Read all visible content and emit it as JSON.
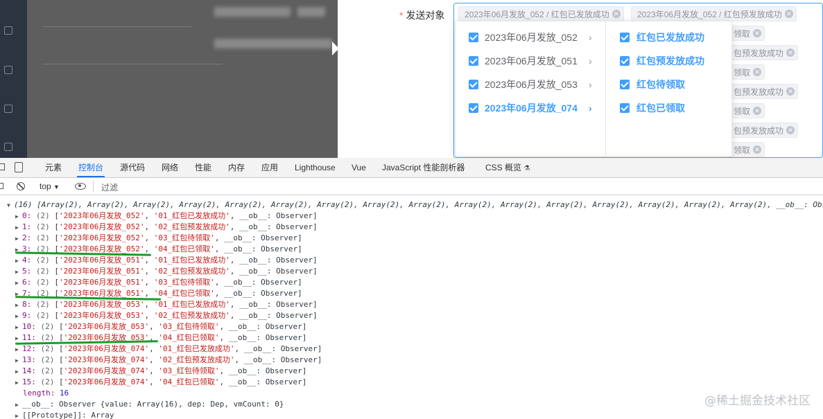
{
  "form": {
    "required_mark": "*",
    "label": "发送对象"
  },
  "selected_tags": [
    {
      "text": "2023年06月发放_052 / 红包已发放成功"
    },
    {
      "text": "2023年06月发放_052 / 红包预发放成功"
    },
    {
      "text": "领取"
    },
    {
      "text": "包预发放成功"
    },
    {
      "text": "领取"
    },
    {
      "text": "包预发放成功"
    },
    {
      "text": "领取"
    },
    {
      "text": "包预发放成功"
    },
    {
      "text": "领取"
    }
  ],
  "cascader": {
    "col1": [
      {
        "label": "2023年06月发放_052",
        "checked": true,
        "active": false
      },
      {
        "label": "2023年06月发放_051",
        "checked": true,
        "active": false
      },
      {
        "label": "2023年06月发放_053",
        "checked": true,
        "active": false
      },
      {
        "label": "2023年06月发放_074",
        "checked": true,
        "active": true
      }
    ],
    "col2": [
      {
        "label": "红包已发放成功",
        "checked": true
      },
      {
        "label": "红包预发放成功",
        "checked": true
      },
      {
        "label": "红包待领取",
        "checked": true
      },
      {
        "label": "红包已领取",
        "checked": true
      }
    ]
  },
  "devtools": {
    "tabs": [
      "元素",
      "控制台",
      "源代码",
      "网络",
      "性能",
      "内存",
      "应用",
      "Lighthouse",
      "Vue",
      "JavaScript 性能剖析器",
      "CSS 概览"
    ],
    "active_tab": "控制台",
    "context": "top",
    "filter_placeholder": "过滤"
  },
  "console": {
    "header": "(16) [Array(2), Array(2), Array(2), Array(2), Array(2), Array(2), Array(2), Array(2), Array(2), Array(2), Array(2), Array(2), Array(2), Array(2), Array(2), Array(2), __ob__: Obs",
    "rows": [
      {
        "idx": "0:",
        "cnt": "(2)",
        "a": "'2023年06月发放_052'",
        "b": "'01_红包已发放成功'",
        "tail": "__ob__: Observer]"
      },
      {
        "idx": "1:",
        "cnt": "(2)",
        "a": "'2023年06月发放_052'",
        "b": "'02_红包预发放成功'",
        "tail": "__ob__: Observer]"
      },
      {
        "idx": "2:",
        "cnt": "(2)",
        "a": "'2023年06月发放_052'",
        "b": "'03_红包待领取'",
        "tail": "__ob__: Observer]"
      },
      {
        "idx": "3:",
        "cnt": "(2)",
        "a": "'2023年06月发放_052'",
        "b": "'04_红包已领取'",
        "tail": "__ob__: Observer]"
      },
      {
        "idx": "4:",
        "cnt": "(2)",
        "a": "'2023年06月发放_051'",
        "b": "'01_红包已发放成功'",
        "tail": "__ob__: Observer]"
      },
      {
        "idx": "5:",
        "cnt": "(2)",
        "a": "'2023年06月发放_051'",
        "b": "'02_红包预发放成功'",
        "tail": "__ob__: Observer]"
      },
      {
        "idx": "6:",
        "cnt": "(2)",
        "a": "'2023年06月发放_051'",
        "b": "'03_红包待领取'",
        "tail": "__ob__: Observer]"
      },
      {
        "idx": "7:",
        "cnt": "(2)",
        "a": "'2023年06月发放_051'",
        "b": "'04_红包已领取'",
        "tail": "__ob__: Observer]"
      },
      {
        "idx": "8:",
        "cnt": "(2)",
        "a": "'2023年06月发放_053'",
        "b": "'01_红包已发放成功'",
        "tail": "__ob__: Observer]"
      },
      {
        "idx": "9:",
        "cnt": "(2)",
        "a": "'2023年06月发放_053'",
        "b": "'02_红包预发放成功'",
        "tail": "__ob__: Observer]"
      },
      {
        "idx": "10:",
        "cnt": "(2)",
        "a": "'2023年06月发放_053'",
        "b": "'03_红包待领取'",
        "tail": "__ob__: Observer]"
      },
      {
        "idx": "11:",
        "cnt": "(2)",
        "a": "'2023年06月发放_053'",
        "b": "'04_红包已领取'",
        "tail": "__ob__: Observer]"
      },
      {
        "idx": "12:",
        "cnt": "(2)",
        "a": "'2023年06月发放_074'",
        "b": "'01_红包已发放成功'",
        "tail": "__ob__: Observer]"
      },
      {
        "idx": "13:",
        "cnt": "(2)",
        "a": "'2023年06月发放_074'",
        "b": "'02_红包预发放成功'",
        "tail": "__ob__: Observer]"
      },
      {
        "idx": "14:",
        "cnt": "(2)",
        "a": "'2023年06月发放_074'",
        "b": "'03_红包待领取'",
        "tail": "__ob__: Observer]"
      },
      {
        "idx": "15:",
        "cnt": "(2)",
        "a": "'2023年06月发放_074'",
        "b": "'04_红包已领取'",
        "tail": "__ob__: Observer]"
      }
    ],
    "length_key": "length:",
    "length_value": "16",
    "ob_line": "__ob__: Observer {value: Array(16), dep: Dep, vmCount: 0}",
    "proto_line": "[[Prototype]]: Array"
  },
  "watermark": "@稀土掘金技术社区"
}
